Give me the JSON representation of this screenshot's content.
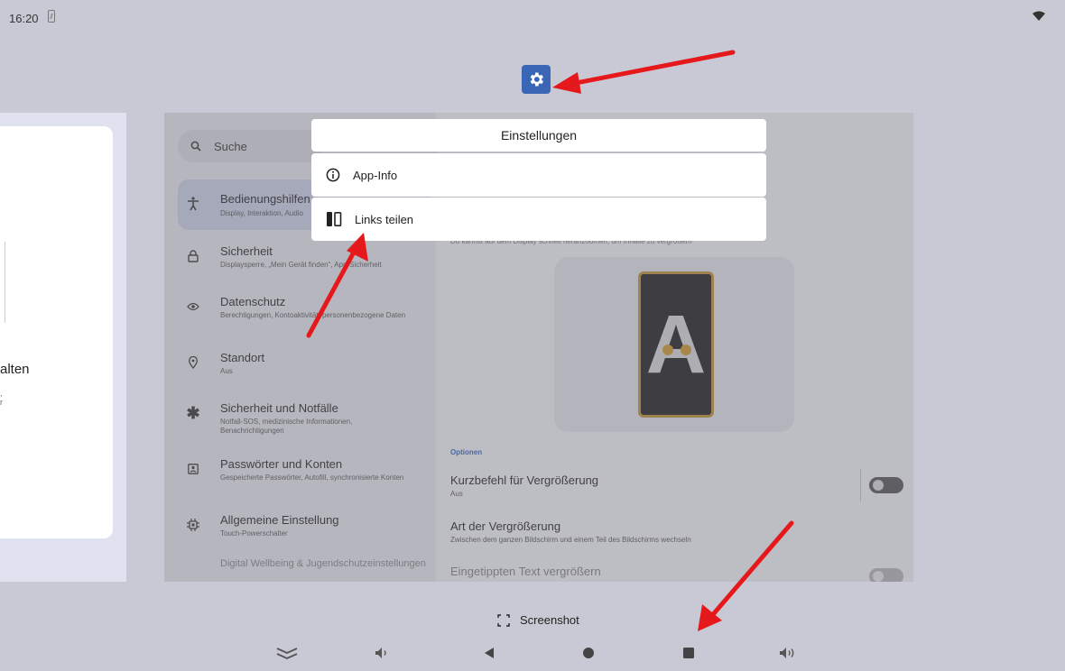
{
  "status_bar": {
    "time": "16:20"
  },
  "left_card": {
    "text": "alten",
    "sub1": ",",
    "sub2": "r"
  },
  "settings": {
    "search_placeholder": "Suche",
    "items": [
      {
        "title": "Bedienungshilfen",
        "sub": "Display, Interaktion, Audio"
      },
      {
        "title": "Sicherheit",
        "sub": "Displaysperre, „Mein Gerät finden“, App-Sicherheit"
      },
      {
        "title": "Datenschutz",
        "sub": "Berechtigungen, Kontoaktivität, personenbezogene Daten"
      },
      {
        "title": "Standort",
        "sub": "Aus"
      },
      {
        "title": "Sicherheit und Notfälle",
        "sub": "Notfall-SOS, medizinische Informationen, Benachrichtigungen"
      },
      {
        "title": "Passwörter und Konten",
        "sub": "Gespeicherte Passwörter, Autofill, synchronisierte Konten"
      },
      {
        "title": "Allgemeine Einstellung",
        "sub": "Touch-Powerschalter"
      },
      {
        "title": "Digital Wellbeing & Jugendschutzeinstellungen",
        "sub": ""
      }
    ],
    "description": "Du kannst auf dem Display schnell heranzoomen, um Inhalte zu vergrößern",
    "preview_letter": "A",
    "section_label": "Optionen",
    "options": [
      {
        "title": "Kurzbefehl für Vergrößerung",
        "sub": "Aus"
      },
      {
        "title": "Art der Vergrößerung",
        "sub": "Zwischen dem ganzen Bildschirm und einem Teil des Bildschirms wechseln"
      },
      {
        "title": "Eingetippten Text vergrößern",
        "sub": ""
      }
    ]
  },
  "popup": {
    "title": "Einstellungen",
    "items": [
      {
        "label": "App-Info",
        "icon": "info-icon"
      },
      {
        "label": "Links teilen",
        "icon": "split-screen-icon"
      }
    ]
  },
  "bottom": {
    "screenshot_label": "Screenshot"
  },
  "colors": {
    "accent": "#3a66b6",
    "arrow": "#e5191c",
    "background": "#c9c9d5"
  }
}
